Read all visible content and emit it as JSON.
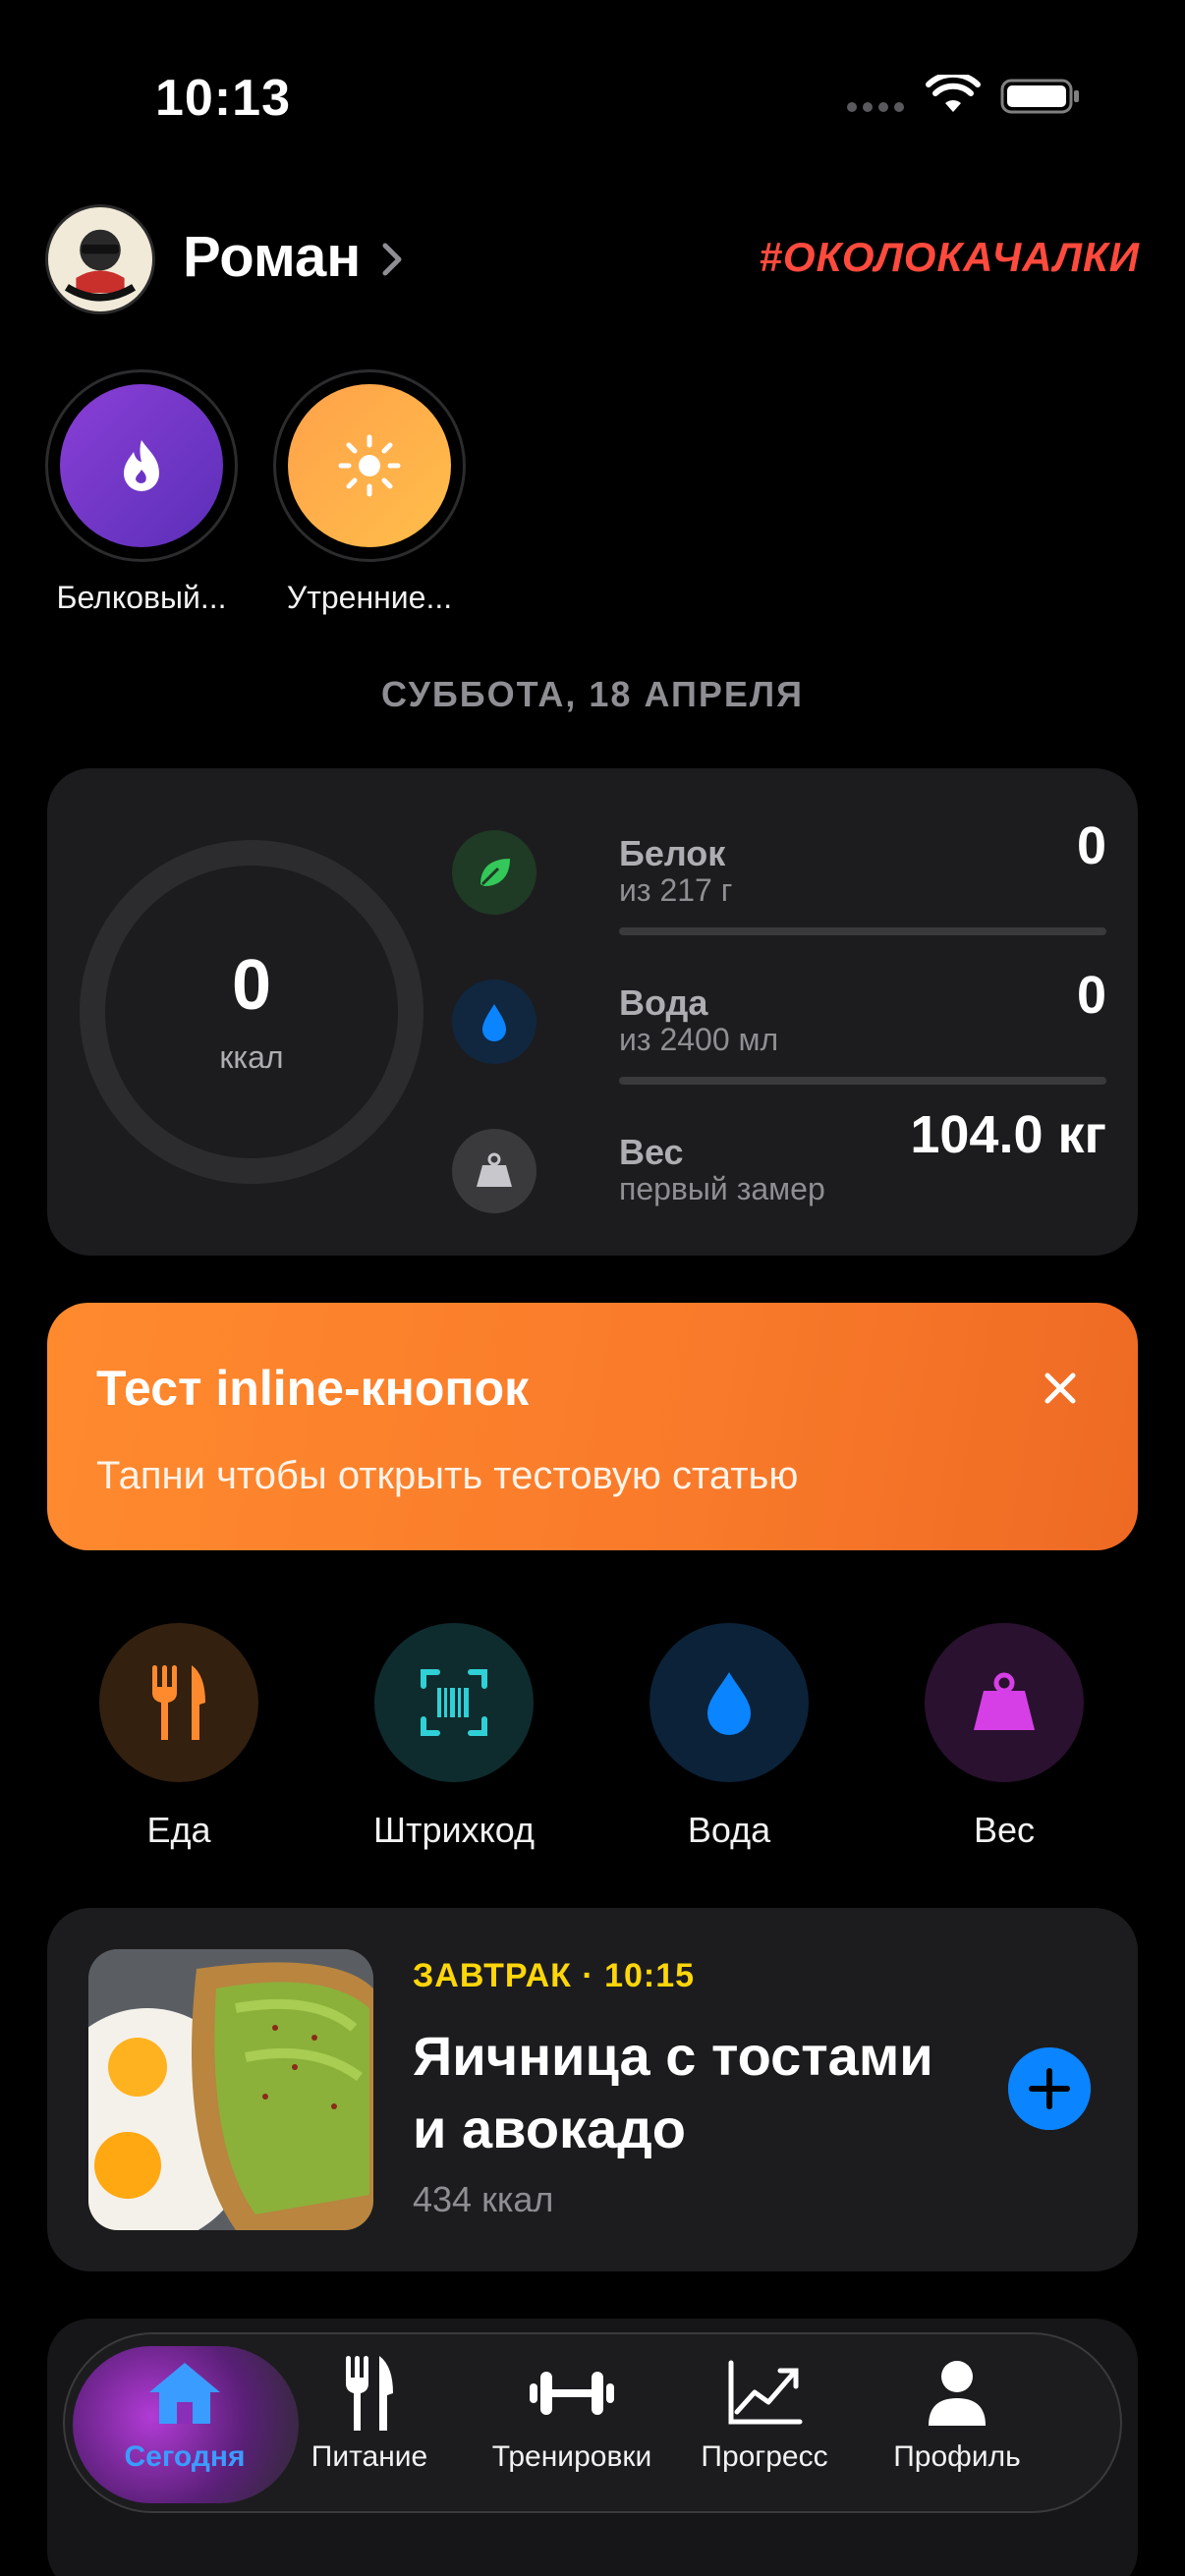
{
  "status_bar": {
    "time": "10:13"
  },
  "header": {
    "user_name": "Роман",
    "brand": "#ОКОЛОКАЧАЛКИ"
  },
  "stories": [
    {
      "label": "Белковый...",
      "icon": "flame-icon",
      "color": "#7b3fd1"
    },
    {
      "label": "Утренние...",
      "icon": "sun-icon",
      "color": "#ffa53a"
    }
  ],
  "date": "СУББОТА, 18 АПРЕЛЯ",
  "summary": {
    "kcal_value": "0",
    "kcal_unit": "ккал",
    "protein": {
      "title": "Белок",
      "sub": "из 217 г",
      "value": "0",
      "progress": 0
    },
    "water": {
      "title": "Вода",
      "sub": "из 2400 мл",
      "value": "0",
      "progress": 0
    },
    "weight": {
      "title": "Вес",
      "sub": "первый замер",
      "value": "104.0 кг"
    }
  },
  "promo": {
    "title": "Тест inline-кнопок",
    "subtitle": "Тапни чтобы открыть тестовую статью",
    "color": "#f97a2a"
  },
  "quick_actions": [
    {
      "label": "Еда",
      "icon": "fork-knife-icon",
      "color": "#ff8a2e"
    },
    {
      "label": "Штрихкод",
      "icon": "barcode-icon",
      "color": "#2fd0d6"
    },
    {
      "label": "Вода",
      "icon": "water-drop-icon",
      "color": "#0a84ff"
    },
    {
      "label": "Вес",
      "icon": "weight-icon",
      "color": "#d63fe6"
    }
  ],
  "meal": {
    "tag": "ЗАВТРАК · 10:15",
    "title": "Яичница с тостами и авокадо",
    "kcal": "434 ккал"
  },
  "tabs": [
    {
      "label": "Сегодня",
      "icon": "home-icon",
      "active": true
    },
    {
      "label": "Питание",
      "icon": "fork-knife-icon"
    },
    {
      "label": "Тренировки",
      "icon": "dumbbell-icon"
    },
    {
      "label": "Прогресс",
      "icon": "chart-icon"
    },
    {
      "label": "Профиль",
      "icon": "person-icon"
    }
  ],
  "accent_colors": {
    "brand": "#ff4a3d",
    "active_tab": "#3b9cff",
    "meal_tag": "#ffd60a"
  }
}
